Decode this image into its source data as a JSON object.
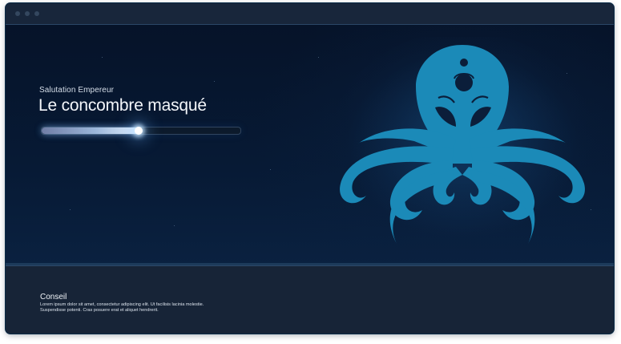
{
  "window": {
    "controls": [
      "window-dot-icon",
      "window-dot-icon",
      "window-dot-icon"
    ]
  },
  "loading": {
    "subtitle": "Salutation Empereur",
    "title": "Le concombre masqué",
    "progress_fraction": 0.49
  },
  "mascot": {
    "icon": "octopus-icon",
    "color": "#1b8ab8"
  },
  "tip": {
    "title": "Conseil",
    "line1": "Lorem ipsum dolor sit amet, consectetur adipiscing elit. Ut facilisis lacinia molestie.",
    "line2": "Suspendisse potenti. Cras posuere erat et aliquet hendrerit."
  },
  "colors": {
    "background": "#0a1628",
    "panel": "#172437",
    "accent": "#1b8ab8"
  }
}
